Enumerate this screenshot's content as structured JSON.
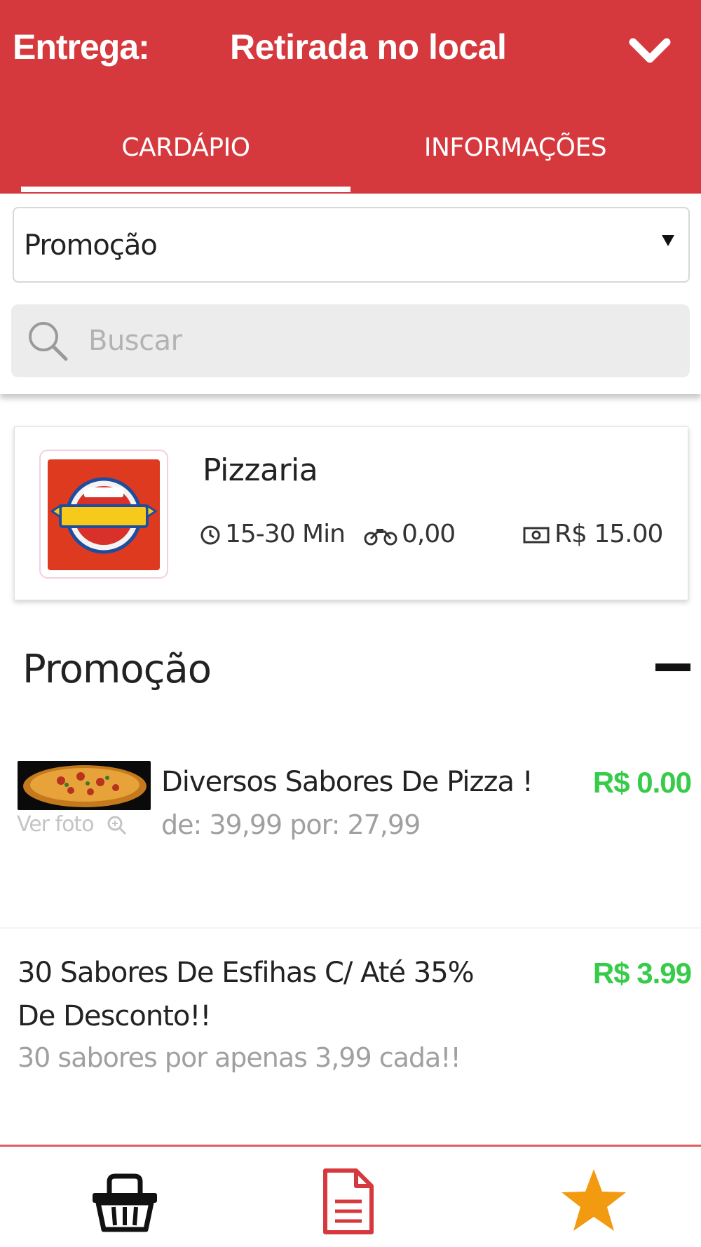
{
  "header": {
    "delivery_label": "Entrega:",
    "delivery_value": "Retirada no local",
    "dropdown_icon": "chevron-down-icon"
  },
  "tabs": [
    {
      "label": "CARDÁPIO",
      "active": true
    },
    {
      "label": "INFORMAÇÕES",
      "active": false
    }
  ],
  "filter": {
    "category_selected": "Promoção",
    "search_placeholder": "Buscar",
    "search_icon": "search-icon"
  },
  "store": {
    "name": "Pizzaria",
    "delivery_time": "15-30 Min",
    "delivery_fee": "0,00",
    "minimum_order": "R$ 15.00"
  },
  "section": {
    "title": "Promoção",
    "collapse_icon": "minus-icon"
  },
  "products": [
    {
      "name": "Diversos Sabores De Pizza !",
      "description": "de: 39,99 por: 27,99",
      "price": "R$ 0.00",
      "photo_link": "Ver foto"
    },
    {
      "name": "30 Sabores De Esfihas C/ Até 35% De Desconto!!",
      "description": "30 sabores por apenas 3,99 cada!!",
      "price": "R$ 3.99"
    }
  ],
  "bottom_nav": [
    {
      "icon": "basket-icon"
    },
    {
      "icon": "document-icon"
    },
    {
      "icon": "star-icon"
    }
  ],
  "colors": {
    "brand_red": "#d6393d",
    "price_green": "#36cc4a",
    "star_orange": "#f29a10"
  }
}
